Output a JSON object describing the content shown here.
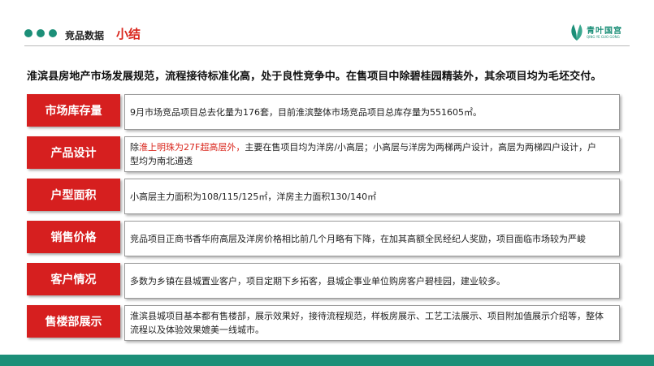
{
  "header": {
    "section_label": "竞品数据",
    "title": "小结",
    "logo_text": "青叶国宫",
    "logo_subtext": "QING YE GUO GONG"
  },
  "summary": "淮滨县房地产市场发展规范，流程接待标准化高，处于良性竞争中。在售项目中除碧桂园精装外，其余项目均为毛坯交付。",
  "rows": [
    {
      "label": "市场库存量",
      "text": "9月市场竞品项目总去化量为176套，目前淮滨整体市场竞品项目总库存量为551605㎡。"
    },
    {
      "label": "产品设计",
      "pre": "除",
      "highlight": "淮上明珠为27F超高层外，",
      "text": "主要在售项目均为洋房/小高层；小高层与洋房为两梯两户设计，高层为两梯四户设计，户型均为南北通透"
    },
    {
      "label": "户型面积",
      "text": "小高层主力面积为108/115/125㎡，洋房主力面积130/140㎡"
    },
    {
      "label": "销售价格",
      "text": "竞品项目正商书香华府高层及洋房价格相比前几个月略有下降，在加其高额全民经纪人奖励，项目面临市场较为严峻"
    },
    {
      "label": "客户情况",
      "text": "多数为乡镇在县城置业客户，项目定期下乡拓客，县城企事业单位购房客户碧桂园，建业较多。"
    },
    {
      "label": "售楼部展示",
      "text": "淮滨县城项目基本都有售楼部，展示效果好，接待流程规范，样板房展示、工艺工法展示、项目附加值展示介绍等，整体流程以及体验效果媲美一线城市。"
    }
  ],
  "colors": {
    "accent_red": "#d61f1f",
    "brand_green": "#1c8f78"
  }
}
